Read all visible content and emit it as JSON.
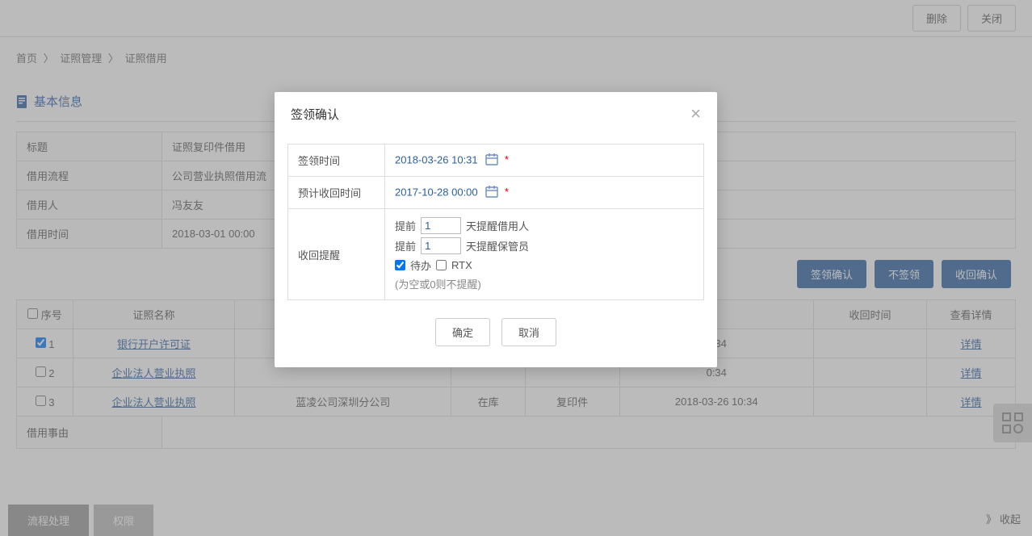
{
  "toolbar": {
    "delete": "删除",
    "close": "关闭"
  },
  "breadcrumb": {
    "home": "首页",
    "sep": "〉",
    "level1": "证照管理",
    "level2": "证照借用"
  },
  "section": {
    "basic_info": "基本信息"
  },
  "info": {
    "title_label": "标题",
    "title_value": "证照复印件借用",
    "flow_label": "借用流程",
    "flow_value": "公司营业执照借用流",
    "borrower_label": "借用人",
    "borrower_value": "冯友友",
    "borrow_time_label": "借用时间",
    "borrow_time_value": "2018-03-01 00:00"
  },
  "actions": {
    "sign_confirm": "签领确认",
    "no_sign": "不签领",
    "return_confirm": "收回确认"
  },
  "table": {
    "headers": {
      "seq": "序号",
      "name": "证照名称",
      "return_time": "收回时间",
      "detail": "查看详情"
    },
    "rows": [
      {
        "seq": "1",
        "name": "银行开户许可证",
        "org": "",
        "status": "",
        "type": "",
        "sign_time": "0:34",
        "detail": "详情",
        "checked": true
      },
      {
        "seq": "2",
        "name": "企业法人营业执照",
        "org": "",
        "status": "",
        "type": "",
        "sign_time": "0:34",
        "detail": "详情",
        "checked": false
      },
      {
        "seq": "3",
        "name": "企业法人营业执照",
        "org": "蓝凌公司深圳分公司",
        "status": "在库",
        "type": "复印件",
        "sign_time": "2018-03-26 10:34",
        "detail": "详情",
        "checked": false
      }
    ]
  },
  "reason": {
    "label": "借用事由"
  },
  "tabs": {
    "process": "流程处理",
    "permission": "权限"
  },
  "collapse": "收起",
  "modal": {
    "title": "签领确认",
    "sign_time_label": "签领时间",
    "sign_time_value": "2018-03-26 10:31",
    "expect_return_label": "预计收回时间",
    "expect_return_value": "2017-10-28 00:00",
    "reminder_label": "收回提醒",
    "before": "提前",
    "days_borrower_value": "1",
    "days_borrower_suffix": "天提醒借用人",
    "days_keeper_value": "1",
    "days_keeper_suffix": "天提醒保管员",
    "todo": "待办",
    "rtx": "RTX",
    "hint": "(为空或0则不提醒)",
    "ok": "确定",
    "cancel": "取消"
  }
}
